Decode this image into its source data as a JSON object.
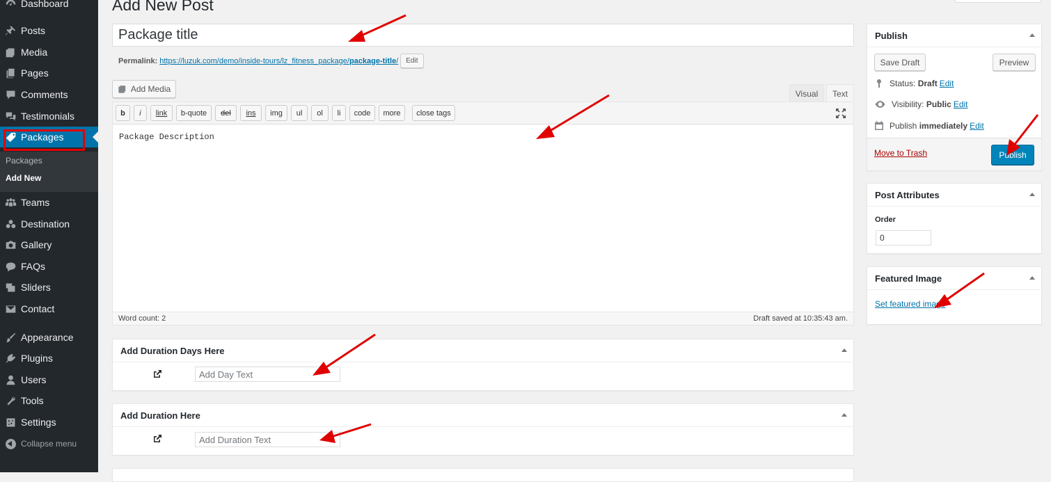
{
  "sidebar": {
    "items": [
      {
        "label": "Dashboard",
        "icon": "dashboard-icon"
      },
      {
        "label": "Posts",
        "icon": "pin-icon"
      },
      {
        "label": "Media",
        "icon": "media-icon"
      },
      {
        "label": "Pages",
        "icon": "pages-icon"
      },
      {
        "label": "Comments",
        "icon": "comment-icon"
      },
      {
        "label": "Testimonials",
        "icon": "testimonial-icon"
      },
      {
        "label": "Packages",
        "icon": "tag-icon"
      },
      {
        "label": "Teams",
        "icon": "groups-icon"
      },
      {
        "label": "Destination",
        "icon": "destination-icon"
      },
      {
        "label": "Gallery",
        "icon": "camera-icon"
      },
      {
        "label": "FAQs",
        "icon": "faq-icon"
      },
      {
        "label": "Sliders",
        "icon": "slides-icon"
      },
      {
        "label": "Contact",
        "icon": "mail-icon"
      },
      {
        "label": "Appearance",
        "icon": "paint-brush-icon"
      },
      {
        "label": "Plugins",
        "icon": "plugin-icon"
      },
      {
        "label": "Users",
        "icon": "user-icon"
      },
      {
        "label": "Tools",
        "icon": "wrench-icon"
      },
      {
        "label": "Settings",
        "icon": "settings-icon"
      }
    ],
    "submenu": [
      "Packages",
      "Add New"
    ],
    "collapse": "Collapse menu"
  },
  "page": {
    "title": "Add New Post"
  },
  "editor": {
    "title_value": "Package title",
    "permalink_label": "Permalink:",
    "permalink_base": "https://luzuk.com/demo/inside-tours/lz_fitness_package/",
    "permalink_slug": "package-title",
    "permalink_end": "/",
    "permalink_edit": "Edit",
    "add_media": "Add Media",
    "tabs": [
      "Visual",
      "Text"
    ],
    "quicktags": [
      "b",
      "i",
      "link",
      "b-quote",
      "del",
      "ins",
      "img",
      "ul",
      "ol",
      "li",
      "code",
      "more",
      "close tags"
    ],
    "content": "Package Description",
    "word_count": "Word count: 2",
    "draft_saved": "Draft saved at 10:35:43 am."
  },
  "meta_boxes": {
    "duration_days": {
      "title": "Add Duration Days Here",
      "placeholder": "Add Day Text"
    },
    "duration": {
      "title": "Add Duration Here",
      "placeholder": "Add Duration Text"
    }
  },
  "publish": {
    "title": "Publish",
    "save_draft": "Save Draft",
    "preview": "Preview",
    "status_label": "Status:",
    "status_value": "Draft",
    "visibility_label": "Visibility:",
    "visibility_value": "Public",
    "publish_label": "Publish",
    "publish_value": "immediately",
    "edit": "Edit",
    "trash": "Move to Trash",
    "publish_button": "Publish"
  },
  "attributes": {
    "title": "Post Attributes",
    "order_label": "Order",
    "order_value": "0"
  },
  "featured": {
    "title": "Featured Image",
    "link": "Set featured image"
  },
  "colors": {
    "sidebar_bg": "#23282d",
    "active_bg": "#0073aa",
    "primary_button": "#0085ba",
    "annotation_red": "#e00000"
  }
}
